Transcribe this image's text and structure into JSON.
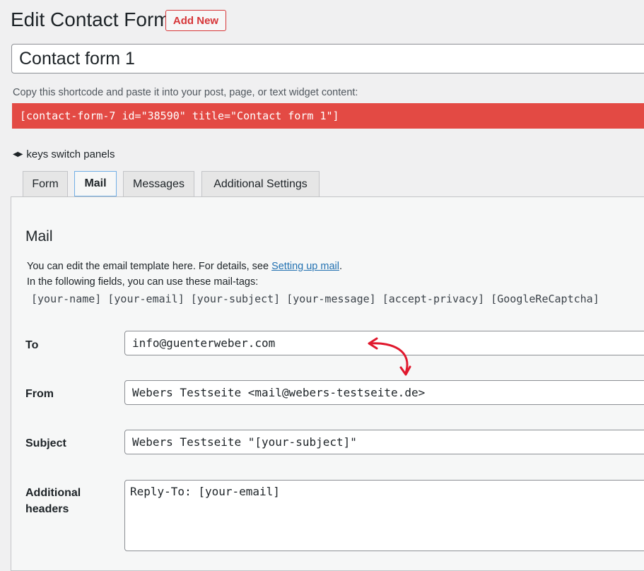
{
  "header": {
    "title": "Edit Contact Form",
    "add_new_label": "Add New"
  },
  "form_title": {
    "value": "Contact form 1"
  },
  "shortcode": {
    "hint": "Copy this shortcode and paste it into your post, page, or text widget content:",
    "value": "[contact-form-7 id=\"38590\" title=\"Contact form 1\"]",
    "highlight_color": "#e34a44"
  },
  "keys_hint": {
    "icon": "left-right-arrows-icon",
    "text": "keys switch panels"
  },
  "tabs": [
    {
      "label": "Form",
      "active": false
    },
    {
      "label": "Mail",
      "active": true
    },
    {
      "label": "Messages",
      "active": false
    },
    {
      "label": "Additional Settings",
      "active": false
    }
  ],
  "mail_panel": {
    "title": "Mail",
    "intro_prefix": "You can edit the email template here. For details, see ",
    "intro_link": "Setting up mail",
    "intro_suffix": ".",
    "tags_intro": "In the following fields, you can use these mail-tags:",
    "mail_tags": "[your-name] [your-email] [your-subject] [your-message] [accept-privacy] [GoogleReCaptcha]",
    "fields": {
      "to": {
        "label": "To",
        "value": "info@guenterweber.com"
      },
      "from": {
        "label": "From",
        "value": "Webers Testseite <mail@webers-testseite.de>"
      },
      "subject": {
        "label": "Subject",
        "value": "Webers Testseite \"[your-subject]\""
      },
      "additional_headers": {
        "label_line1": "Additional",
        "label_line2": "headers",
        "value": "Reply-To: [your-email]"
      }
    }
  },
  "annotation": {
    "icon": "curved-double-arrow-icon",
    "color": "#e0182d"
  }
}
